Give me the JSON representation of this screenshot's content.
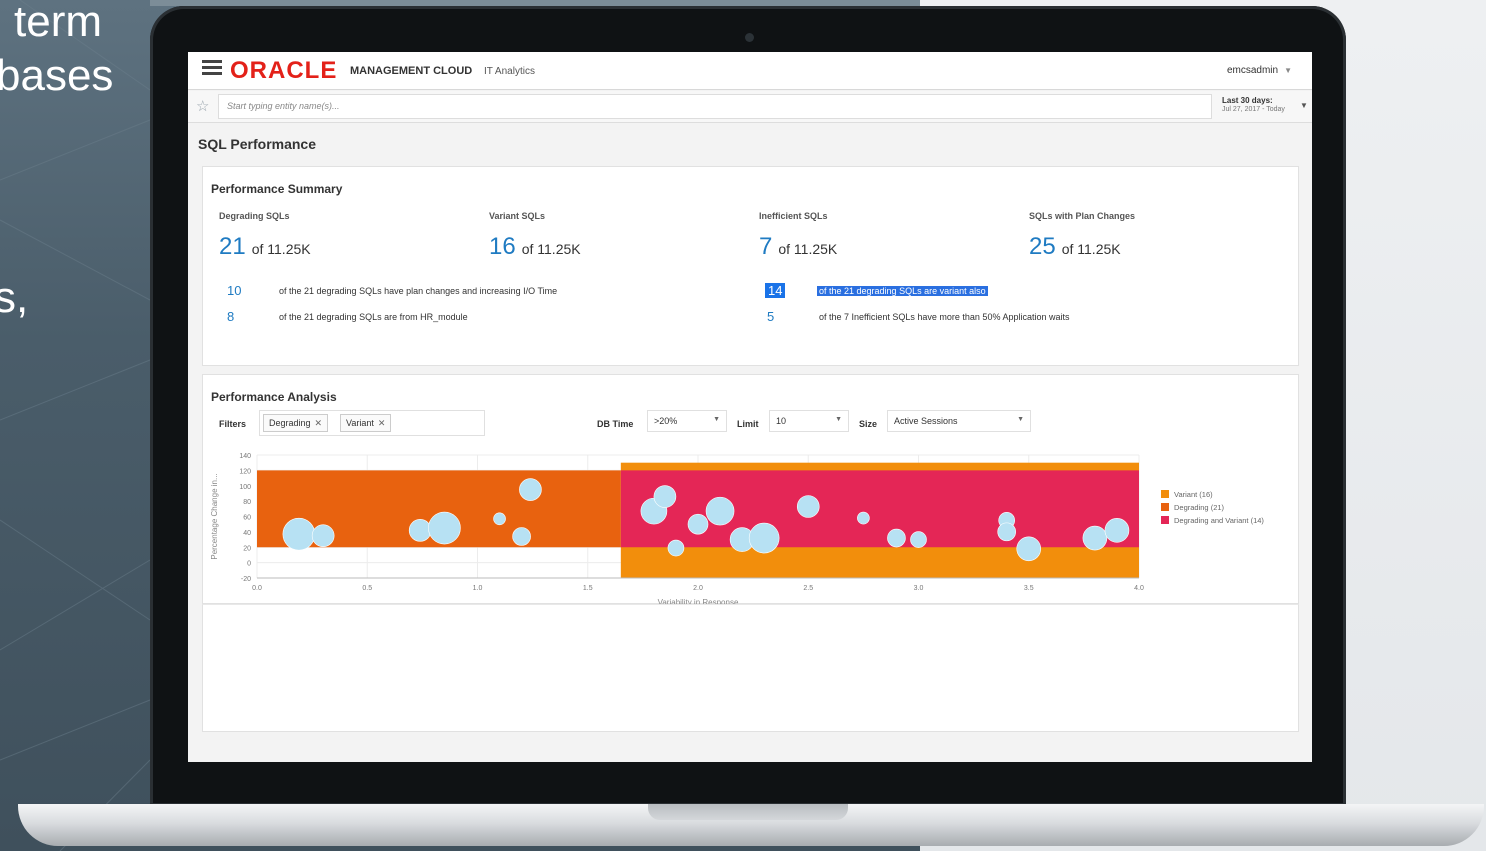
{
  "slide_text": {
    "line1": "term",
    "line2": "bases",
    "line3": "s,"
  },
  "header": {
    "logo": "ORACLE",
    "app_name": "MANAGEMENT CLOUD",
    "sub_app": "IT Analytics",
    "user": "emcsadmin",
    "menu_icon": "hamburger-icon"
  },
  "search": {
    "placeholder": "Start typing entity name(s)...",
    "date_range_label": "Last 30 days:",
    "date_range_value": "Jul 27, 2017 - Today"
  },
  "page_title": "SQL Performance",
  "summary": {
    "title": "Performance Summary",
    "metrics": [
      {
        "label": "Degrading SQLs",
        "value": "21",
        "total": "of 11.25K"
      },
      {
        "label": "Variant SQLs",
        "value": "16",
        "total": "of 11.25K"
      },
      {
        "label": "Inefficient SQLs",
        "value": "7",
        "total": "of 11.25K"
      },
      {
        "label": "SQLs with Plan Changes",
        "value": "25",
        "total": "of 11.25K"
      }
    ],
    "details": [
      {
        "num": "10",
        "text": "of the 21 degrading SQLs have plan changes and increasing I/O Time"
      },
      {
        "num": "8",
        "text": "of the 21 degrading SQLs are from HR_module"
      },
      {
        "num": "14",
        "text": "of the 21 degrading SQLs are variant also"
      },
      {
        "num": "5",
        "text": "of the 7 Inefficient SQLs have more than 50% Application waits"
      }
    ]
  },
  "analysis": {
    "title": "Performance Analysis",
    "filters_label": "Filters",
    "filter_chips": [
      "Degrading",
      "Variant"
    ],
    "db_time_label": "DB Time",
    "db_time_value": ">20%",
    "limit_label": "Limit",
    "limit_value": "10",
    "size_label": "Size",
    "size_value": "Active Sessions"
  },
  "chart_data": {
    "type": "scatter",
    "xlabel": "Variability in Response",
    "ylabel": "Percentage Change in...",
    "xlim": [
      0,
      4.0
    ],
    "ylim": [
      -20,
      140
    ],
    "x_ticks": [
      "0.0",
      "0.5",
      "1.0",
      "1.5",
      "2.0",
      "2.5",
      "3.0",
      "3.5",
      "4.0"
    ],
    "y_ticks": [
      "140",
      "120",
      "100",
      "80",
      "60",
      "40",
      "20",
      "0",
      "-20"
    ],
    "grid": true,
    "legend_position": "right",
    "regions": [
      {
        "name": "Degrading (21)",
        "color": "#e8620f",
        "x0": 0,
        "x1": 1.65,
        "y0": 20,
        "y1": 120
      },
      {
        "name": "Variant (16)",
        "color": "#f28e0c",
        "x0": 1.65,
        "x1": 4.0,
        "y0": -20,
        "y1": 130
      },
      {
        "name": "Degrading and Variant (14)",
        "color": "#e42656",
        "x0": 1.65,
        "x1": 4.0,
        "y0": 20,
        "y1": 120
      }
    ],
    "legend": [
      {
        "name": "Variant (16)",
        "color": "#f28e0c"
      },
      {
        "name": "Degrading (21)",
        "color": "#e8620f"
      },
      {
        "name": "Degrading and Variant (14)",
        "color": "#e42656"
      }
    ],
    "points": [
      {
        "x": 0.19,
        "y": 37,
        "size": 16
      },
      {
        "x": 0.3,
        "y": 35,
        "size": 11
      },
      {
        "x": 0.74,
        "y": 42,
        "size": 11
      },
      {
        "x": 0.85,
        "y": 45,
        "size": 16
      },
      {
        "x": 1.1,
        "y": 57,
        "size": 6
      },
      {
        "x": 1.2,
        "y": 34,
        "size": 9
      },
      {
        "x": 1.24,
        "y": 95,
        "size": 11
      },
      {
        "x": 1.8,
        "y": 67,
        "size": 13
      },
      {
        "x": 1.85,
        "y": 86,
        "size": 11
      },
      {
        "x": 1.9,
        "y": 19,
        "size": 8
      },
      {
        "x": 2.0,
        "y": 50,
        "size": 10
      },
      {
        "x": 2.1,
        "y": 67,
        "size": 14
      },
      {
        "x": 2.2,
        "y": 30,
        "size": 12
      },
      {
        "x": 2.3,
        "y": 32,
        "size": 15
      },
      {
        "x": 2.5,
        "y": 73,
        "size": 11
      },
      {
        "x": 2.75,
        "y": 58,
        "size": 6
      },
      {
        "x": 2.9,
        "y": 32,
        "size": 9
      },
      {
        "x": 3.0,
        "y": 30,
        "size": 8
      },
      {
        "x": 3.4,
        "y": 55,
        "size": 8
      },
      {
        "x": 3.4,
        "y": 40,
        "size": 9
      },
      {
        "x": 3.5,
        "y": 18,
        "size": 12
      },
      {
        "x": 3.8,
        "y": 32,
        "size": 12
      },
      {
        "x": 3.9,
        "y": 42,
        "size": 12
      }
    ]
  }
}
